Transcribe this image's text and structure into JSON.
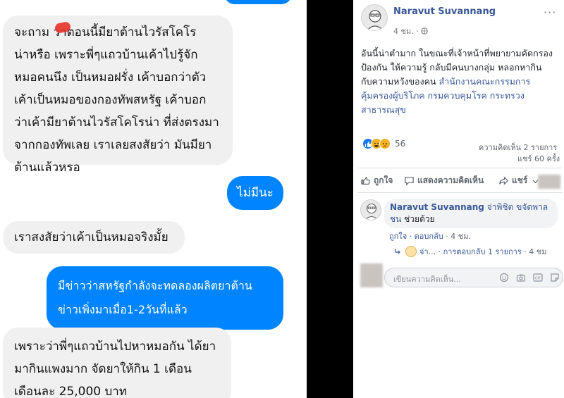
{
  "chat": {
    "messages": [
      {
        "lines": [
          "จะถาม  ว่าตอนนี้มียาต้านไวรัสโคโร",
          "น่าหรือ เพราะพี่ๆแถวบ้านเค้าไปรู้จัก",
          "หมอคนนึง เป็นหมอฝรั่ง เค้าบอกว่าตัว",
          "เค้าเป็นหมอของกองทัพสหรัฐ เค้าบอก",
          "ว่าเค้ามียาต้านไวรัสโคโรน่า ที่ส่งตรงมา",
          "จากกองทัพเลย เราเลยสงสัยว่า มันมียา",
          "ต้านแล้วหรอ"
        ]
      },
      {
        "lines": [
          "ไม่มีนะ"
        ]
      },
      {
        "lines": [
          "เราสงสัยว่าเค้าเป็นหมอจริงมั้ย"
        ]
      },
      {
        "lines": [
          "มีข่าวว่าสหรัฐกำลังจะทดลองผลิตยาต้าน",
          "ข่าวเพิ่งมาเมื่อ1-2วันที่แล้ว"
        ]
      },
      {
        "lines": [
          "เพราะว่าพี่ๆแถวบ้านไปหาหมอกัน ได้ยา",
          "มากินแพงมาก จัดยาให้กิน 1 เดือน",
          "เดือนละ 25,000 บาท"
        ]
      }
    ]
  },
  "post": {
    "author": "Naravut Suvannang",
    "time": "4 ชม.",
    "more": "···",
    "text_lines": [
      "อันนี้น่าตำมาก ในขณะที่เจ้าหน้าที่พยายามคัดกรอง",
      "ป้องกัน ให้ความรู้ กลับมีคนบางกลุ่ม หลอกหากิน",
      "กับความหวังของคน"
    ],
    "link_lines": [
      "สำนักงานคณะกรรมการ",
      "คุ้มครองผู้บริโภค กรมควบคุมโรค กระทรวง",
      "สาธารณสุข"
    ],
    "reaction_count": "56",
    "comment_count": "ความคิดเห็น 2 รายการ",
    "share_count": "แชร์ 60 ครั้ง",
    "actions": {
      "like": "ถูกใจ",
      "comment": "แสดงความคิดเห็น",
      "share": "แชร์"
    }
  },
  "comment": {
    "author": "Naravut Suvannang",
    "mention": "จ่าพิชิต ขจัดพาล",
    "line2_mention": "ชน",
    "line2_text": " ช่วยด้วย",
    "like": "ถูกใจ",
    "reply": "ตอบกลับ",
    "time": "4 ชม.",
    "reply_name": "จ่า...",
    "reply_summary": "การตอบกลับ 1 รายการ",
    "reply_time": "4 ชม"
  },
  "composer": {
    "placeholder": "เขียนความคิดเห็น..."
  },
  "colors": {
    "messenger_blue": "#0084ff",
    "fb_link": "#385898",
    "fb_like_blue": "#1877f2"
  },
  "icons": [
    "like-icon",
    "comment-icon",
    "share-icon",
    "globe-icon",
    "emoji-icon",
    "camera-icon",
    "gif-icon",
    "sticker-icon"
  ]
}
